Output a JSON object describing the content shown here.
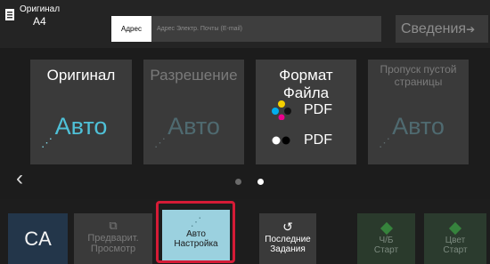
{
  "header": {
    "original_title": "Оригинал",
    "original_size": "A4",
    "address_label": "Адрес",
    "address_placeholder": "Адрес Электр. Почты (E-mail)",
    "details_label": "Сведения",
    "details_icon": "arrow-right-icon"
  },
  "tiles": [
    {
      "title": "Оригинал",
      "value": "Авто",
      "enabled": true,
      "icon": "auto-wand-icon"
    },
    {
      "title": "Разрешение",
      "value": "Авто",
      "enabled": false,
      "icon": "auto-wand-icon"
    },
    {
      "title": "Формат Файла",
      "enabled": true,
      "formats": [
        {
          "label": "PDF",
          "icon": "color-dots-icon"
        },
        {
          "label": "PDF",
          "icon": "bw-dots-icon"
        }
      ]
    },
    {
      "title": "Пропуск пустой страницы",
      "value": "Авто",
      "enabled": false,
      "icon": "auto-wand-icon"
    }
  ],
  "pager": {
    "pages": 2,
    "current": 2
  },
  "actions": {
    "ca_label": "CA",
    "preview_line1": "Предварит.",
    "preview_line2": "Просмотр",
    "auto_line1": "Авто",
    "auto_line2": "Настройка",
    "jobs_line1": "Последние",
    "jobs_line2": "Задания",
    "bw_line1": "Ч/Б",
    "bw_line2": "Старт",
    "color_line1": "Цвет",
    "color_line2": "Старт"
  },
  "colors": {
    "accent_value": "#4fc1d8",
    "ca_background": "#23364a",
    "auto_button": "#9bd1df",
    "highlight": "#d51b36",
    "start_green": "#3fbf4a"
  }
}
